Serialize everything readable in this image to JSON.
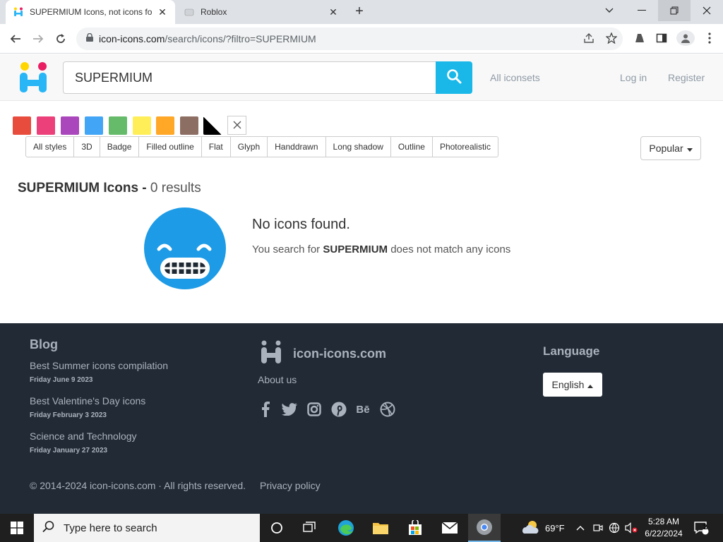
{
  "browser": {
    "tabs": [
      {
        "title": "SUPERMIUM Icons, not icons fo",
        "close": "✕"
      },
      {
        "title": "Roblox",
        "close": "✕"
      }
    ],
    "new_tab": "+",
    "url_host": "icon-icons.com",
    "url_path": "/search/icons/?filtro=SUPERMIUM"
  },
  "header": {
    "search_value": "SUPERMIUM",
    "all_iconsets": "All iconsets",
    "login": "Log in",
    "register": "Register"
  },
  "colors": {
    "swatches": [
      "#e84c3d",
      "#ec407a",
      "#ab47bc",
      "#42a5f5",
      "#66bb6a",
      "#ffee58",
      "#ffa726",
      "#8d6e63",
      "black-white"
    ],
    "accent": "#1ab8e8",
    "footer_bg": "#222b35"
  },
  "styles": [
    "All styles",
    "3D",
    "Badge",
    "Filled outline",
    "Flat",
    "Glyph",
    "Handdrawn",
    "Long shadow",
    "Outline",
    "Photorealistic"
  ],
  "sort": {
    "label": "Popular"
  },
  "results": {
    "query": "SUPERMIUM Icons -",
    "count": "0 results",
    "not_found": "No icons found.",
    "desc_prefix": "You search for",
    "desc_query": "SUPERMIUM",
    "desc_suffix": "does not match any icons"
  },
  "footer": {
    "blog_heading": "Blog",
    "posts": [
      {
        "title": "Best Summer icons compilation",
        "date": "Friday June 9 2023"
      },
      {
        "title": "Best Valentine's Day icons",
        "date": "Friday February 3 2023"
      },
      {
        "title": "Science and Technology",
        "date": "Friday January 27 2023"
      }
    ],
    "brand": "icon-icons.com",
    "about": "About us",
    "social": [
      "facebook-icon",
      "twitter-icon",
      "instagram-icon",
      "pinterest-icon",
      "behance-icon",
      "dribbble-icon"
    ],
    "behance_text": "Bē",
    "language_heading": "Language",
    "language": "English",
    "copyright": "© 2014-2024 icon-icons.com · All rights reserved.",
    "privacy": "Privacy policy"
  },
  "taskbar": {
    "search_placeholder": "Type here to search",
    "weather": "69°F",
    "time": "5:28 AM",
    "date": "6/22/2024",
    "notifications": "2"
  }
}
